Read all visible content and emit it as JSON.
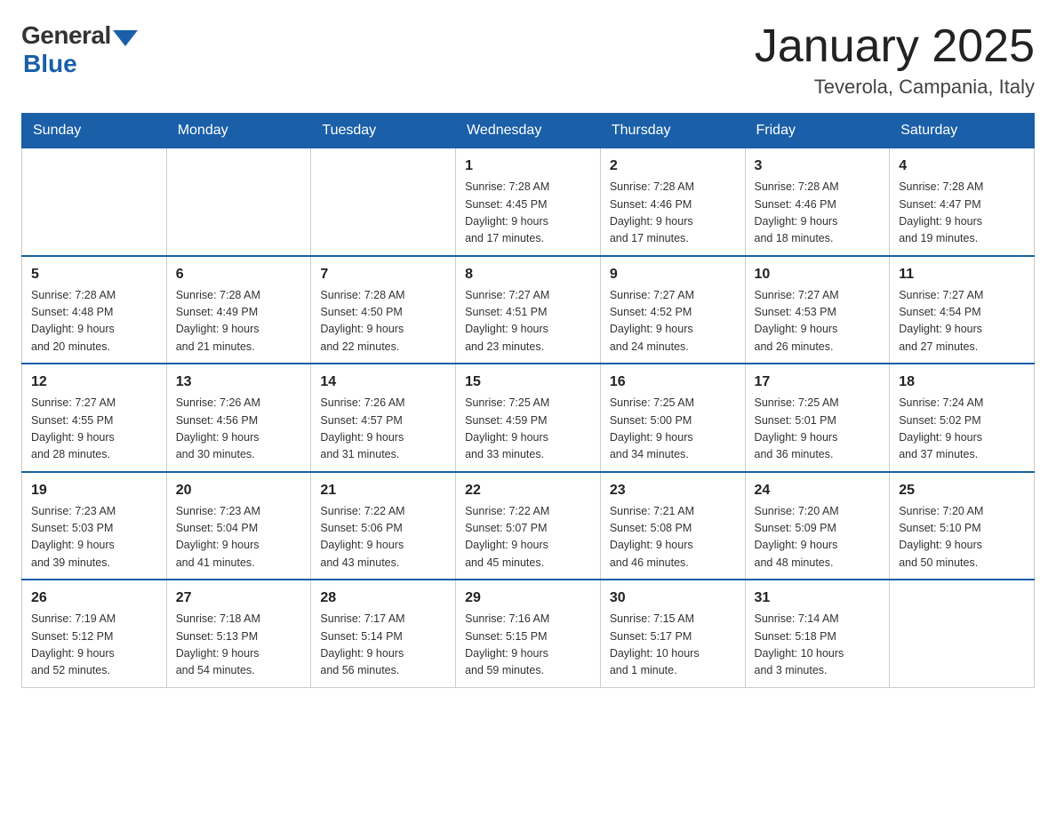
{
  "logo": {
    "general": "General",
    "blue": "Blue"
  },
  "title": "January 2025",
  "location": "Teverola, Campania, Italy",
  "days_of_week": [
    "Sunday",
    "Monday",
    "Tuesday",
    "Wednesday",
    "Thursday",
    "Friday",
    "Saturday"
  ],
  "weeks": [
    [
      {
        "num": "",
        "info": ""
      },
      {
        "num": "",
        "info": ""
      },
      {
        "num": "",
        "info": ""
      },
      {
        "num": "1",
        "info": "Sunrise: 7:28 AM\nSunset: 4:45 PM\nDaylight: 9 hours\nand 17 minutes."
      },
      {
        "num": "2",
        "info": "Sunrise: 7:28 AM\nSunset: 4:46 PM\nDaylight: 9 hours\nand 17 minutes."
      },
      {
        "num": "3",
        "info": "Sunrise: 7:28 AM\nSunset: 4:46 PM\nDaylight: 9 hours\nand 18 minutes."
      },
      {
        "num": "4",
        "info": "Sunrise: 7:28 AM\nSunset: 4:47 PM\nDaylight: 9 hours\nand 19 minutes."
      }
    ],
    [
      {
        "num": "5",
        "info": "Sunrise: 7:28 AM\nSunset: 4:48 PM\nDaylight: 9 hours\nand 20 minutes."
      },
      {
        "num": "6",
        "info": "Sunrise: 7:28 AM\nSunset: 4:49 PM\nDaylight: 9 hours\nand 21 minutes."
      },
      {
        "num": "7",
        "info": "Sunrise: 7:28 AM\nSunset: 4:50 PM\nDaylight: 9 hours\nand 22 minutes."
      },
      {
        "num": "8",
        "info": "Sunrise: 7:27 AM\nSunset: 4:51 PM\nDaylight: 9 hours\nand 23 minutes."
      },
      {
        "num": "9",
        "info": "Sunrise: 7:27 AM\nSunset: 4:52 PM\nDaylight: 9 hours\nand 24 minutes."
      },
      {
        "num": "10",
        "info": "Sunrise: 7:27 AM\nSunset: 4:53 PM\nDaylight: 9 hours\nand 26 minutes."
      },
      {
        "num": "11",
        "info": "Sunrise: 7:27 AM\nSunset: 4:54 PM\nDaylight: 9 hours\nand 27 minutes."
      }
    ],
    [
      {
        "num": "12",
        "info": "Sunrise: 7:27 AM\nSunset: 4:55 PM\nDaylight: 9 hours\nand 28 minutes."
      },
      {
        "num": "13",
        "info": "Sunrise: 7:26 AM\nSunset: 4:56 PM\nDaylight: 9 hours\nand 30 minutes."
      },
      {
        "num": "14",
        "info": "Sunrise: 7:26 AM\nSunset: 4:57 PM\nDaylight: 9 hours\nand 31 minutes."
      },
      {
        "num": "15",
        "info": "Sunrise: 7:25 AM\nSunset: 4:59 PM\nDaylight: 9 hours\nand 33 minutes."
      },
      {
        "num": "16",
        "info": "Sunrise: 7:25 AM\nSunset: 5:00 PM\nDaylight: 9 hours\nand 34 minutes."
      },
      {
        "num": "17",
        "info": "Sunrise: 7:25 AM\nSunset: 5:01 PM\nDaylight: 9 hours\nand 36 minutes."
      },
      {
        "num": "18",
        "info": "Sunrise: 7:24 AM\nSunset: 5:02 PM\nDaylight: 9 hours\nand 37 minutes."
      }
    ],
    [
      {
        "num": "19",
        "info": "Sunrise: 7:23 AM\nSunset: 5:03 PM\nDaylight: 9 hours\nand 39 minutes."
      },
      {
        "num": "20",
        "info": "Sunrise: 7:23 AM\nSunset: 5:04 PM\nDaylight: 9 hours\nand 41 minutes."
      },
      {
        "num": "21",
        "info": "Sunrise: 7:22 AM\nSunset: 5:06 PM\nDaylight: 9 hours\nand 43 minutes."
      },
      {
        "num": "22",
        "info": "Sunrise: 7:22 AM\nSunset: 5:07 PM\nDaylight: 9 hours\nand 45 minutes."
      },
      {
        "num": "23",
        "info": "Sunrise: 7:21 AM\nSunset: 5:08 PM\nDaylight: 9 hours\nand 46 minutes."
      },
      {
        "num": "24",
        "info": "Sunrise: 7:20 AM\nSunset: 5:09 PM\nDaylight: 9 hours\nand 48 minutes."
      },
      {
        "num": "25",
        "info": "Sunrise: 7:20 AM\nSunset: 5:10 PM\nDaylight: 9 hours\nand 50 minutes."
      }
    ],
    [
      {
        "num": "26",
        "info": "Sunrise: 7:19 AM\nSunset: 5:12 PM\nDaylight: 9 hours\nand 52 minutes."
      },
      {
        "num": "27",
        "info": "Sunrise: 7:18 AM\nSunset: 5:13 PM\nDaylight: 9 hours\nand 54 minutes."
      },
      {
        "num": "28",
        "info": "Sunrise: 7:17 AM\nSunset: 5:14 PM\nDaylight: 9 hours\nand 56 minutes."
      },
      {
        "num": "29",
        "info": "Sunrise: 7:16 AM\nSunset: 5:15 PM\nDaylight: 9 hours\nand 59 minutes."
      },
      {
        "num": "30",
        "info": "Sunrise: 7:15 AM\nSunset: 5:17 PM\nDaylight: 10 hours\nand 1 minute."
      },
      {
        "num": "31",
        "info": "Sunrise: 7:14 AM\nSunset: 5:18 PM\nDaylight: 10 hours\nand 3 minutes."
      },
      {
        "num": "",
        "info": ""
      }
    ]
  ]
}
